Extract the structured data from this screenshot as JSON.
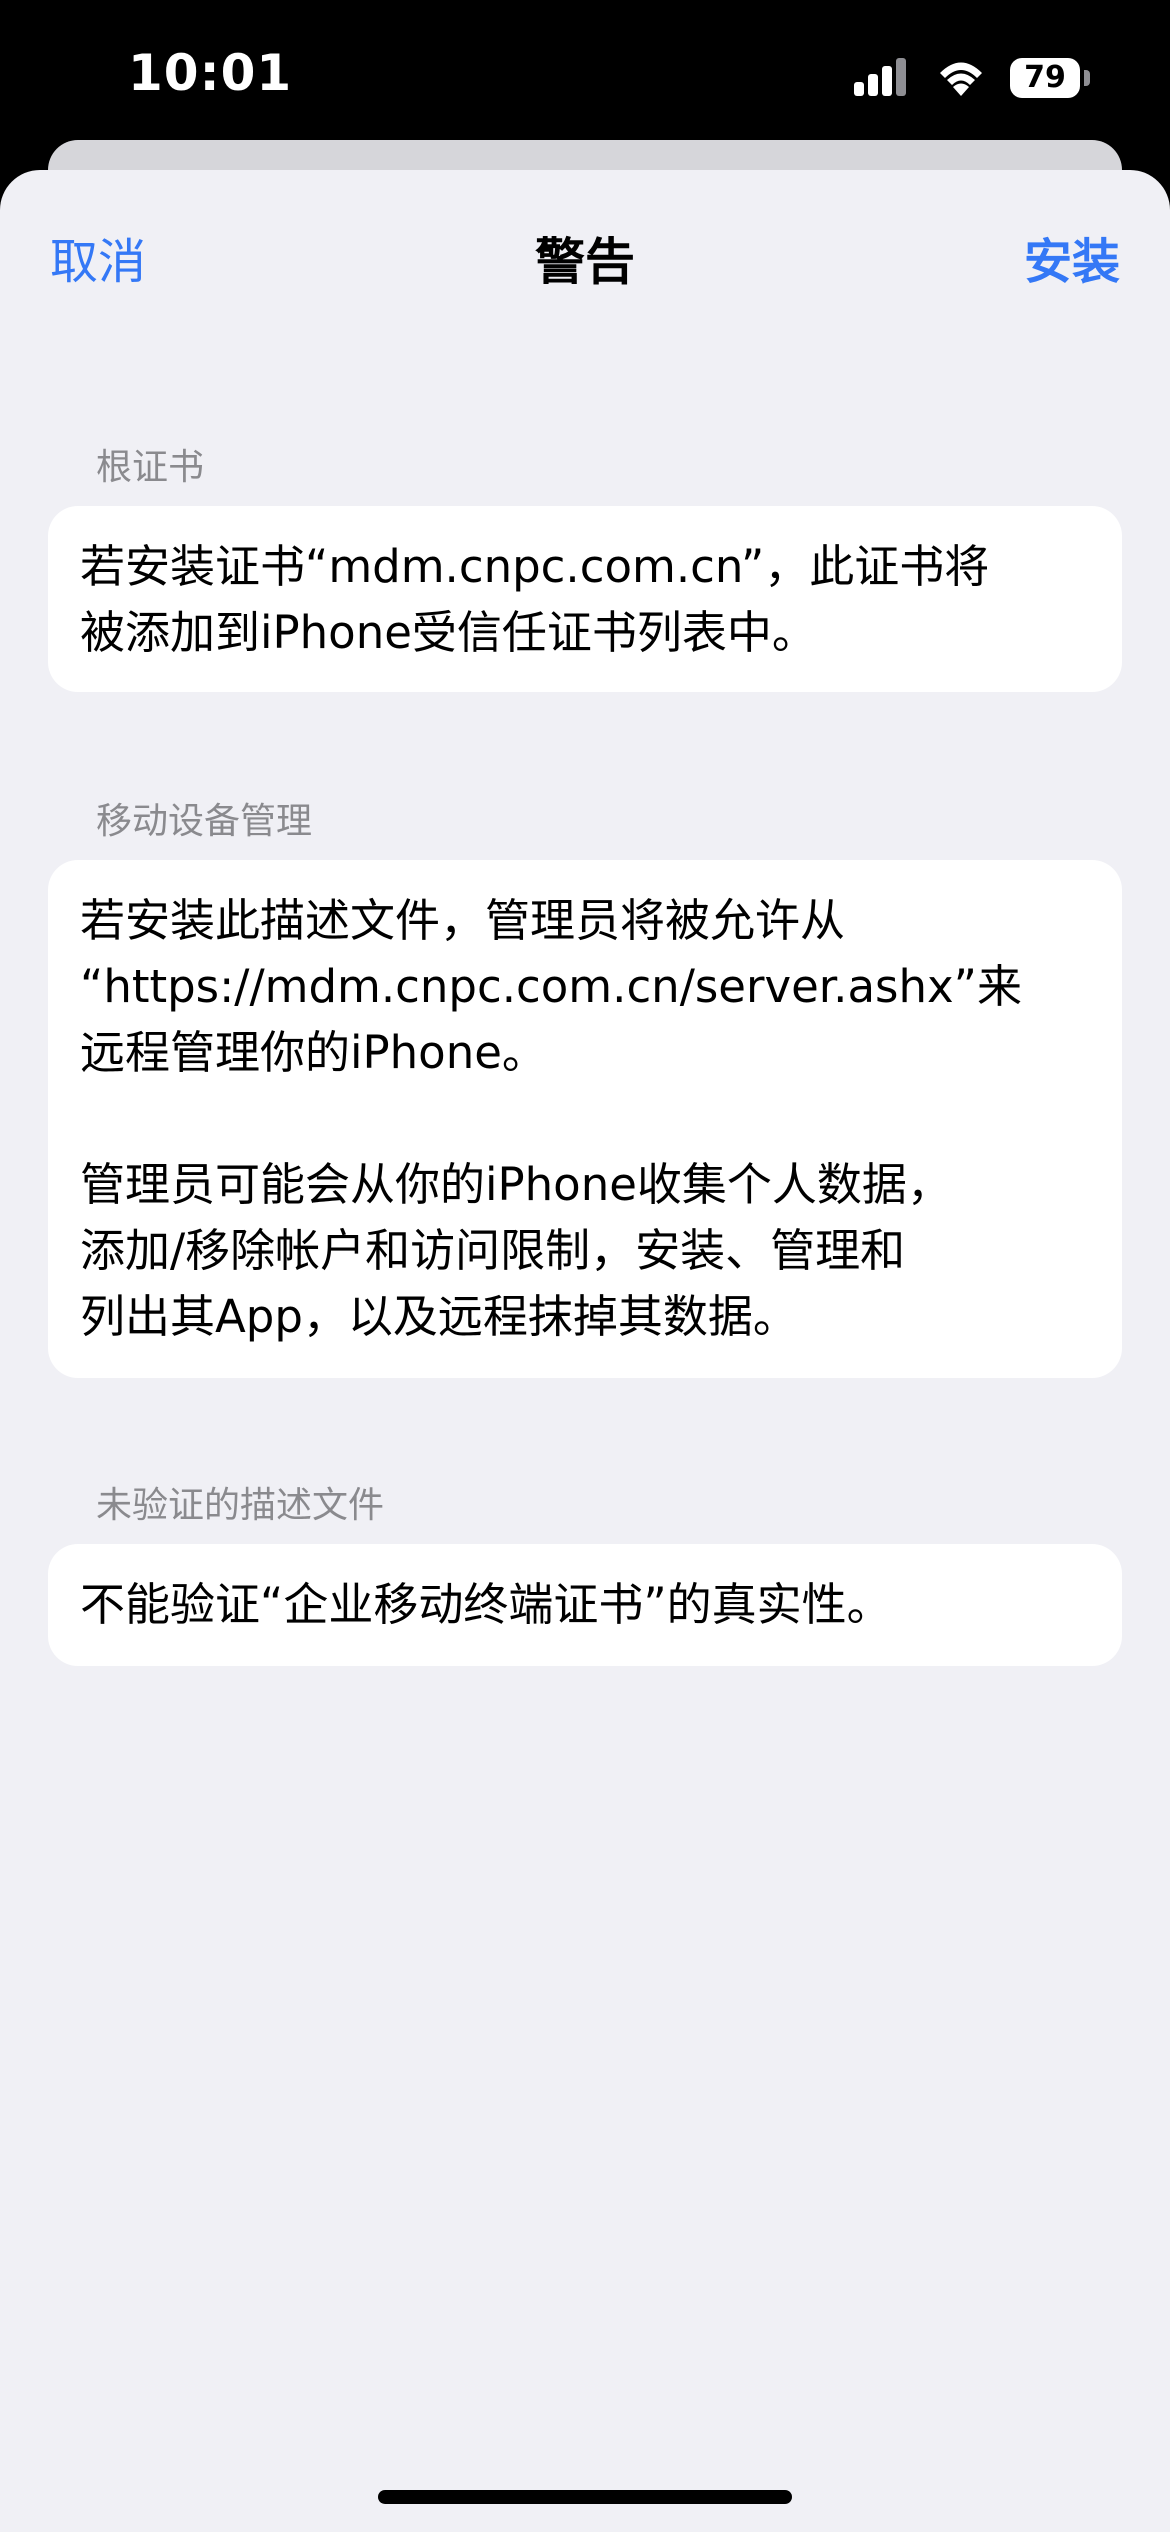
{
  "status_bar": {
    "time": "10:01",
    "battery": "79"
  },
  "nav": {
    "cancel_label": "取消",
    "title": "警告",
    "install_label": "安装"
  },
  "sections": [
    {
      "header": "根证书",
      "paragraphs": [
        "若安装证书“mdm.cnpc.com.cn”，此证书将\n被添加到iPhone受信任证书列表中。"
      ]
    },
    {
      "header": "移动设备管理",
      "paragraphs": [
        "若安装此描述文件，管理员将被允许从\n“https://mdm.cnpc.com.cn/server.ashx”来\n远程管理你的iPhone。",
        "管理员可能会从你的iPhone收集个人数据，\n添加/移除帐户和访问限制，安装、管理和\n列出其App，以及远程抹掉其数据。"
      ]
    },
    {
      "header": "未验证的描述文件",
      "paragraphs": [
        "不能验证“企业移动终端证书”的真实性。"
      ]
    }
  ],
  "colors": {
    "accent": "#3478f6",
    "sheet_background": "#f0f0f5",
    "card_background": "#ffffff",
    "section_header": "#8a8a8e"
  }
}
